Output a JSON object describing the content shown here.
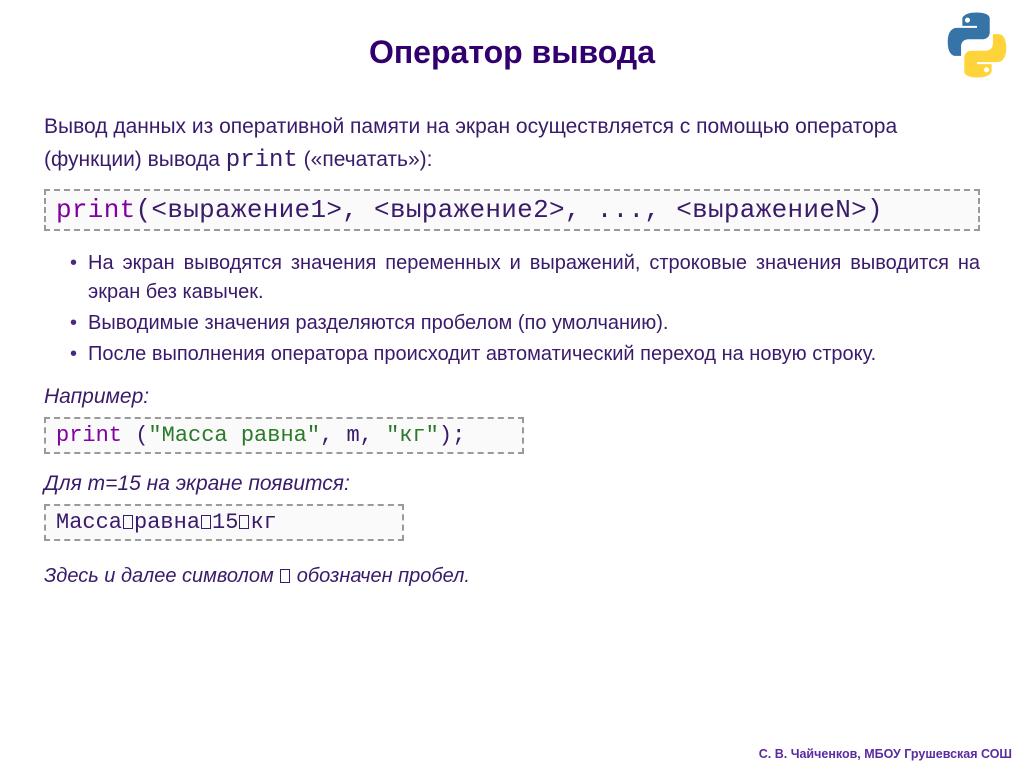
{
  "title": "Оператор вывода",
  "intro_prefix": "Вывод данных из оперативной памяти на экран осуществляется с помощью оператора (функции) вывода ",
  "intro_print": "print",
  "intro_suffix": " («печатать»):",
  "syntax_kw": "print",
  "syntax_rest": "(<выражение1>, <выражение2>, ..., <выражениеN>)",
  "bullets": [
    "На экран выводятся значения переменных и выражений, строковые значения выводится на экран без кавычек.",
    "Выводимые значения разделяются пробелом (по умолчанию).",
    "После выполнения оператора происходит автоматический переход на новую строку."
  ],
  "example_label": "Например:",
  "example_kw": "print",
  "example_open": " (",
  "example_str1": "\"Масса равна\"",
  "example_mid1": ", m, ",
  "example_str2": "\"кг\"",
  "example_end": ");",
  "secondary_label": "Для m=15 на экране появится:",
  "output_parts": [
    "Масса",
    "равна",
    "15",
    "кг"
  ],
  "note_prefix": "Здесь и далее символом ",
  "note_suffix": " обозначен пробел.",
  "footer": "С. В. Чайченков, МБОУ Грушевская СОШ"
}
